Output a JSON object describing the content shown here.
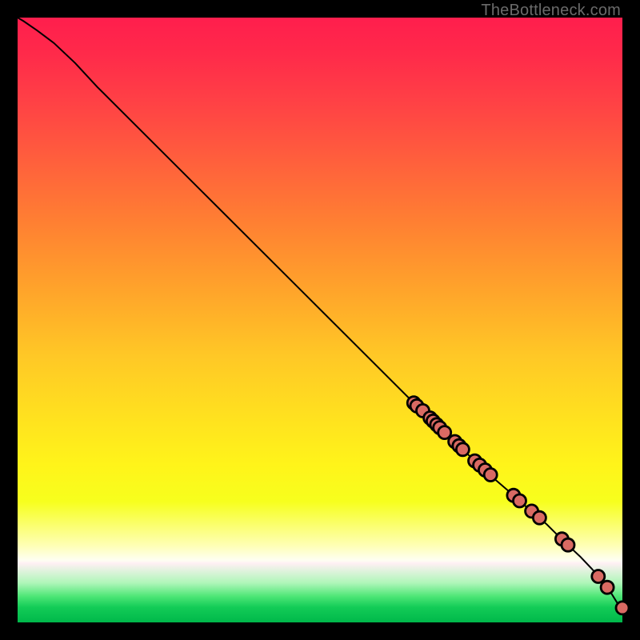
{
  "watermark": "TheBottleneck.com",
  "chart_data": {
    "type": "line",
    "title": "",
    "xlabel": "",
    "ylabel": "",
    "xlim": [
      0,
      100
    ],
    "ylim": [
      0,
      100
    ],
    "grid": false,
    "axes_visible": false,
    "background_gradient": "red-orange-yellow-green (top to bottom)",
    "series": [
      {
        "name": "curve",
        "color": "#000000",
        "x": [
          0.0,
          1.0,
          3.2,
          6.0,
          9.5,
          13.2,
          65.5,
          67.0,
          68.2,
          69.0,
          70.3,
          71.8,
          72.9,
          74.0,
          75.3,
          76.4,
          77.5,
          79.0,
          80.4,
          82.0,
          84.0,
          85.8,
          87.5,
          89.5,
          91.4,
          93.0,
          95.0,
          96.4,
          97.8,
          99.4,
          100.0
        ],
        "y": [
          100.0,
          99.4,
          97.9,
          95.8,
          92.5,
          88.5,
          36.3,
          35.0,
          33.8,
          33.0,
          31.7,
          30.2,
          29.3,
          28.2,
          27.0,
          26.0,
          25.0,
          23.6,
          22.4,
          21.0,
          19.2,
          17.7,
          16.2,
          14.2,
          12.4,
          10.9,
          8.8,
          7.2,
          5.4,
          2.8,
          2.4
        ]
      }
    ],
    "highlight_points": {
      "name": "dots",
      "color": "#d96a63",
      "x": [
        65.5,
        66.0,
        67.0,
        68.2,
        68.7,
        69.3,
        69.8,
        70.6,
        72.3,
        73.0,
        73.6,
        75.6,
        76.4,
        77.3,
        78.2,
        82.0,
        83.0,
        85.0,
        86.3,
        90.0,
        91.0,
        96.0,
        97.5,
        100.0
      ],
      "y": [
        36.3,
        35.8,
        35.0,
        33.8,
        33.3,
        32.7,
        32.2,
        31.4,
        29.9,
        29.2,
        28.6,
        26.7,
        26.0,
        25.2,
        24.4,
        21.0,
        20.1,
        18.4,
        17.3,
        13.8,
        12.8,
        7.6,
        5.8,
        2.4
      ]
    }
  }
}
